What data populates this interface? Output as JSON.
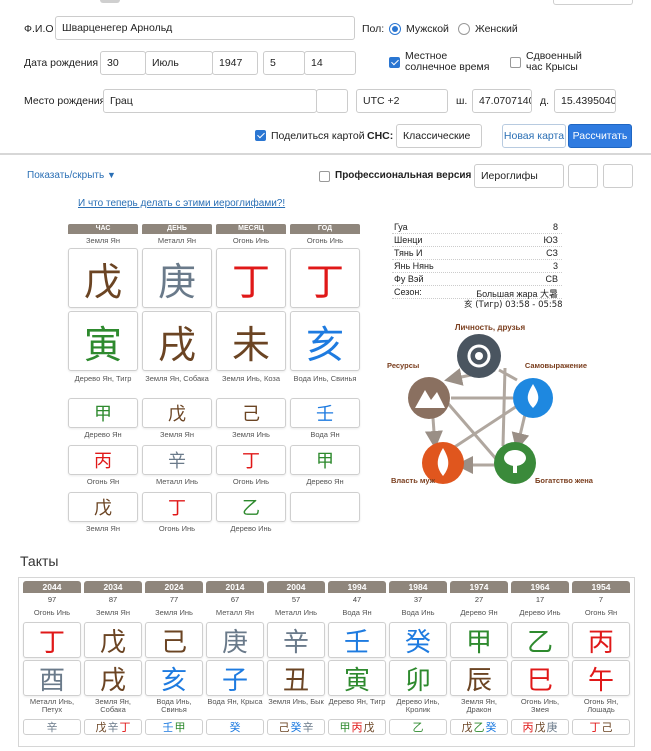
{
  "colors": {
    "fire": "#e01818",
    "earth": "#6b4423",
    "metal": "#6a7a8a",
    "water": "#1e7be0",
    "wood": "#2e8a2e",
    "accent": "#2f7be0"
  },
  "form": {
    "fio_label": "Ф.И.О",
    "fio_value": "Шварценегер Арнольд",
    "gender_label": "Пол:",
    "male_label": "Мужской",
    "female_label": "Женский",
    "birthdate_label": "Дата рождения",
    "day": "30",
    "month": "Июль",
    "year": "1947",
    "hour": "5",
    "minute": "14",
    "solar_time_label": "Местное солнечное время",
    "rat_hour_label": "Сдвоенный час Крысы",
    "birthplace_label": "Место рождения",
    "birthplace_value": "Грац",
    "timezone_value": "UTC +2",
    "lat_label": "ш.",
    "lat_value": "47.0707140",
    "lon_label": "д.",
    "lon_value": "15.4395040",
    "share_label": "Поделиться картой",
    "cns_label": "СНС:",
    "cns_value": "Классические",
    "new_card_button": "Новая карта",
    "calculate_button": "Рассчитать"
  },
  "options": {
    "toggle_label": "Показать/скрыть",
    "pro_label": "Профессиональная версия",
    "glyph_mode": "Иероглифы",
    "help_link": "И что теперь делать с этими иероглифами?!"
  },
  "pillars": {
    "headers": [
      "ЧАС",
      "ДЕНЬ",
      "МЕСЯЦ",
      "ГОД"
    ],
    "stem_names": [
      "Земля Ян",
      "Металл Ян",
      "Огонь Инь",
      "Огонь Инь"
    ],
    "stems": [
      {
        "ch": "戊",
        "el": "earth"
      },
      {
        "ch": "庚",
        "el": "metal"
      },
      {
        "ch": "丁",
        "el": "fire"
      },
      {
        "ch": "丁",
        "el": "fire"
      }
    ],
    "branches": [
      {
        "ch": "寅",
        "el": "wood"
      },
      {
        "ch": "戌",
        "el": "earth"
      },
      {
        "ch": "未",
        "el": "earth"
      },
      {
        "ch": "亥",
        "el": "water"
      }
    ],
    "branch_names": [
      "Дерево Ян, Тигр",
      "Земля Ян, Собака",
      "Земля Инь, Коза",
      "Вода Инь, Свинья"
    ],
    "hidden_rows": [
      [
        {
          "ch": "甲",
          "el": "wood",
          "name": "Дерево Ян"
        },
        {
          "ch": "戊",
          "el": "earth",
          "name": "Земля Ян"
        },
        {
          "ch": "己",
          "el": "earth",
          "name": "Земля Инь"
        },
        {
          "ch": "壬",
          "el": "water",
          "name": "Вода Ян"
        }
      ],
      [
        {
          "ch": "丙",
          "el": "fire",
          "name": "Огонь Ян"
        },
        {
          "ch": "辛",
          "el": "metal",
          "name": "Металл Инь"
        },
        {
          "ch": "丁",
          "el": "fire",
          "name": "Огонь Инь"
        },
        {
          "ch": "甲",
          "el": "wood",
          "name": "Дерево Ян"
        }
      ],
      [
        {
          "ch": "戊",
          "el": "earth",
          "name": "Земля Ян"
        },
        {
          "ch": "丁",
          "el": "fire",
          "name": "Огонь Инь"
        },
        {
          "ch": "乙",
          "el": "wood",
          "name": "Дерево Инь"
        },
        {
          "ch": "",
          "el": "earth",
          "name": ""
        }
      ]
    ]
  },
  "info": {
    "rows": [
      {
        "k": "Гуа",
        "v": "8"
      },
      {
        "k": "Шенци",
        "v": "ЮЗ"
      },
      {
        "k": "Тянь И",
        "v": "СЗ"
      },
      {
        "k": "Янь Нянь",
        "v": "3"
      },
      {
        "k": "Фу Вэй",
        "v": "СВ"
      },
      {
        "k": "Сезон:",
        "v": "Большая жара 大暑"
      }
    ],
    "season_time": "亥 (Тигр) 03:58 - 05:58"
  },
  "cycle": {
    "labels": {
      "top": "Личность, друзья",
      "right": "Самовыражение",
      "left": "Ресурсы",
      "bottom_left": "Власть муж",
      "bottom_right": "Богатство жена"
    }
  },
  "takty": {
    "title": "Такты",
    "years": [
      "2044",
      "2034",
      "2024",
      "2014",
      "2004",
      "1994",
      "1984",
      "1974",
      "1964",
      "1954"
    ],
    "ages": [
      "97",
      "87",
      "77",
      "67",
      "57",
      "47",
      "37",
      "27",
      "17",
      "7"
    ],
    "stem_names": [
      "Огонь Инь",
      "Земля Ян",
      "Земля Инь",
      "Металл Ян",
      "Металл Инь",
      "Вода Ян",
      "Вода Инь",
      "Дерево Ян",
      "Дерево Инь",
      "Огонь Ян"
    ],
    "stems": [
      {
        "ch": "丁",
        "el": "fire"
      },
      {
        "ch": "戊",
        "el": "earth"
      },
      {
        "ch": "己",
        "el": "earth"
      },
      {
        "ch": "庚",
        "el": "metal"
      },
      {
        "ch": "辛",
        "el": "metal"
      },
      {
        "ch": "壬",
        "el": "water"
      },
      {
        "ch": "癸",
        "el": "water"
      },
      {
        "ch": "甲",
        "el": "wood"
      },
      {
        "ch": "乙",
        "el": "wood"
      },
      {
        "ch": "丙",
        "el": "fire"
      }
    ],
    "branches": [
      {
        "ch": "酉",
        "el": "metal"
      },
      {
        "ch": "戌",
        "el": "earth"
      },
      {
        "ch": "亥",
        "el": "water"
      },
      {
        "ch": "子",
        "el": "water"
      },
      {
        "ch": "丑",
        "el": "earth"
      },
      {
        "ch": "寅",
        "el": "wood"
      },
      {
        "ch": "卯",
        "el": "wood"
      },
      {
        "ch": "辰",
        "el": "earth"
      },
      {
        "ch": "巳",
        "el": "fire"
      },
      {
        "ch": "午",
        "el": "fire"
      }
    ],
    "branch_names": [
      "Металл Инь, Петух",
      "Земля Ян, Собака",
      "Вода Инь, Свинья",
      "Вода Ян, Крыса",
      "Земля Инь, Бык",
      "Дерево Ян, Тигр",
      "Дерево Инь, Кролик",
      "Земля Ян, Дракон",
      "Огонь Инь, Змея",
      "Огонь Ян, Лошадь"
    ],
    "hidden": [
      [
        {
          "ch": "辛",
          "el": "metal"
        }
      ],
      [
        {
          "ch": "戊",
          "el": "earth"
        },
        {
          "ch": "辛",
          "el": "metal"
        },
        {
          "ch": "丁",
          "el": "fire"
        }
      ],
      [
        {
          "ch": "壬",
          "el": "water"
        },
        {
          "ch": "甲",
          "el": "wood"
        }
      ],
      [
        {
          "ch": "癸",
          "el": "water"
        }
      ],
      [
        {
          "ch": "己",
          "el": "earth"
        },
        {
          "ch": "癸",
          "el": "water"
        },
        {
          "ch": "辛",
          "el": "metal"
        }
      ],
      [
        {
          "ch": "甲",
          "el": "wood"
        },
        {
          "ch": "丙",
          "el": "fire"
        },
        {
          "ch": "戊",
          "el": "earth"
        }
      ],
      [
        {
          "ch": "乙",
          "el": "wood"
        }
      ],
      [
        {
          "ch": "戊",
          "el": "earth"
        },
        {
          "ch": "乙",
          "el": "wood"
        },
        {
          "ch": "癸",
          "el": "water"
        }
      ],
      [
        {
          "ch": "丙",
          "el": "fire"
        },
        {
          "ch": "戊",
          "el": "earth"
        },
        {
          "ch": "庚",
          "el": "metal"
        }
      ],
      [
        {
          "ch": "丁",
          "el": "fire"
        },
        {
          "ch": "己",
          "el": "earth"
        }
      ]
    ]
  }
}
